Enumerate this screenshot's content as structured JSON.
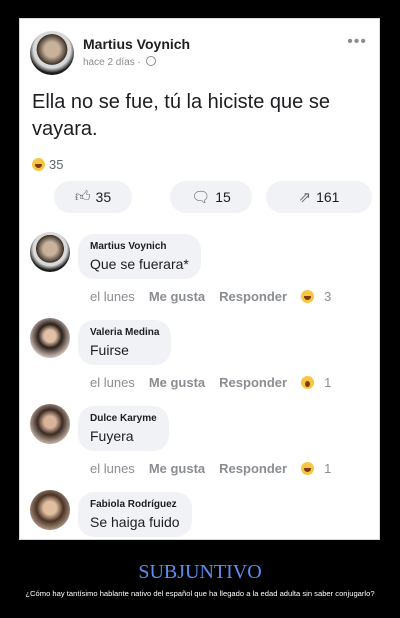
{
  "post": {
    "author": "Martius Voynich",
    "time": "hace 2 días",
    "text": "Ella no se fue, tú la hiciste que se vayara.",
    "reaction_count": "35",
    "actions": [
      {
        "icon": "like-icon",
        "count": "35"
      },
      {
        "icon": "comment-icon",
        "count": "15"
      },
      {
        "icon": "share-icon",
        "count": "161"
      }
    ]
  },
  "comments": [
    {
      "name": "Martius Voynich",
      "text": "Que se fuerara*",
      "time": "el lunes",
      "like": "Me gusta",
      "reply": "Responder",
      "reaction_icon": "haha-emoji-icon",
      "reaction_count": "3"
    },
    {
      "name": "Valeria Medina",
      "text": "Fuirse",
      "time": "el lunes",
      "like": "Me gusta",
      "reply": "Responder",
      "reaction_icon": "wow-emoji-icon",
      "reaction_count": "1"
    },
    {
      "name": "Dulce Karyme",
      "text": "Fuyera",
      "time": "el lunes",
      "like": "Me gusta",
      "reply": "Responder",
      "reaction_icon": "haha-emoji-icon",
      "reaction_count": "1"
    },
    {
      "name": "Fabiola Rodríguez",
      "text": "Se haiga fuido"
    }
  ],
  "caption": {
    "title": "SUBJUNTIVO",
    "subtitle": "¿Cómo hay tantísimo hablante nativo del español que ha llegado a la edad adulta sin saber conjugarlo?"
  },
  "colors": {
    "caption_title": "#5b8ef2",
    "background": "#000000",
    "emoji": "#f7c542"
  }
}
